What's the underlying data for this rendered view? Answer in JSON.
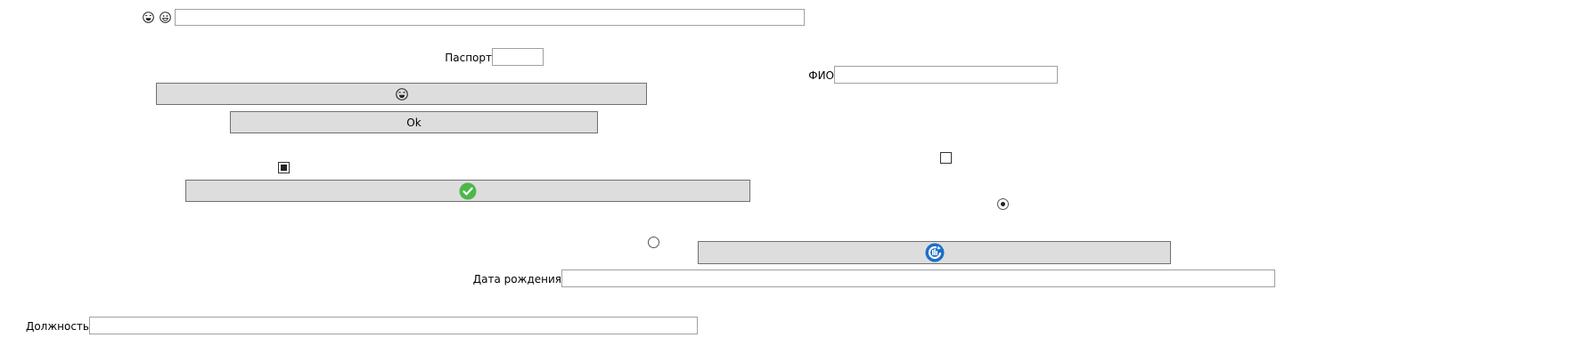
{
  "form": {
    "top_field": {
      "value": "",
      "placeholder": ""
    },
    "top_emojis": [
      "laughing-face-icon",
      "smiling-face-icon"
    ],
    "passport": {
      "label": "Паспорт",
      "value": ""
    },
    "fio": {
      "label": "ФИО",
      "value": ""
    },
    "emoji_button": {
      "icon": "laughing-face-icon"
    },
    "ok_button": {
      "label": "Ok"
    },
    "checkbox_left": {
      "checked": true
    },
    "checkbox_right": {
      "checked": false
    },
    "confirm_button": {
      "icon": "green-checkmark-icon",
      "icon_color": "#4cb848"
    },
    "radio_right": {
      "checked": true
    },
    "radio_left": {
      "checked": false
    },
    "refresh_button": {
      "icon": "blue-refresh-icon",
      "icon_color": "#1a6fc7"
    },
    "birth_date": {
      "label": "Дата рождения",
      "value": ""
    },
    "position": {
      "label": "Должность",
      "value": ""
    }
  }
}
